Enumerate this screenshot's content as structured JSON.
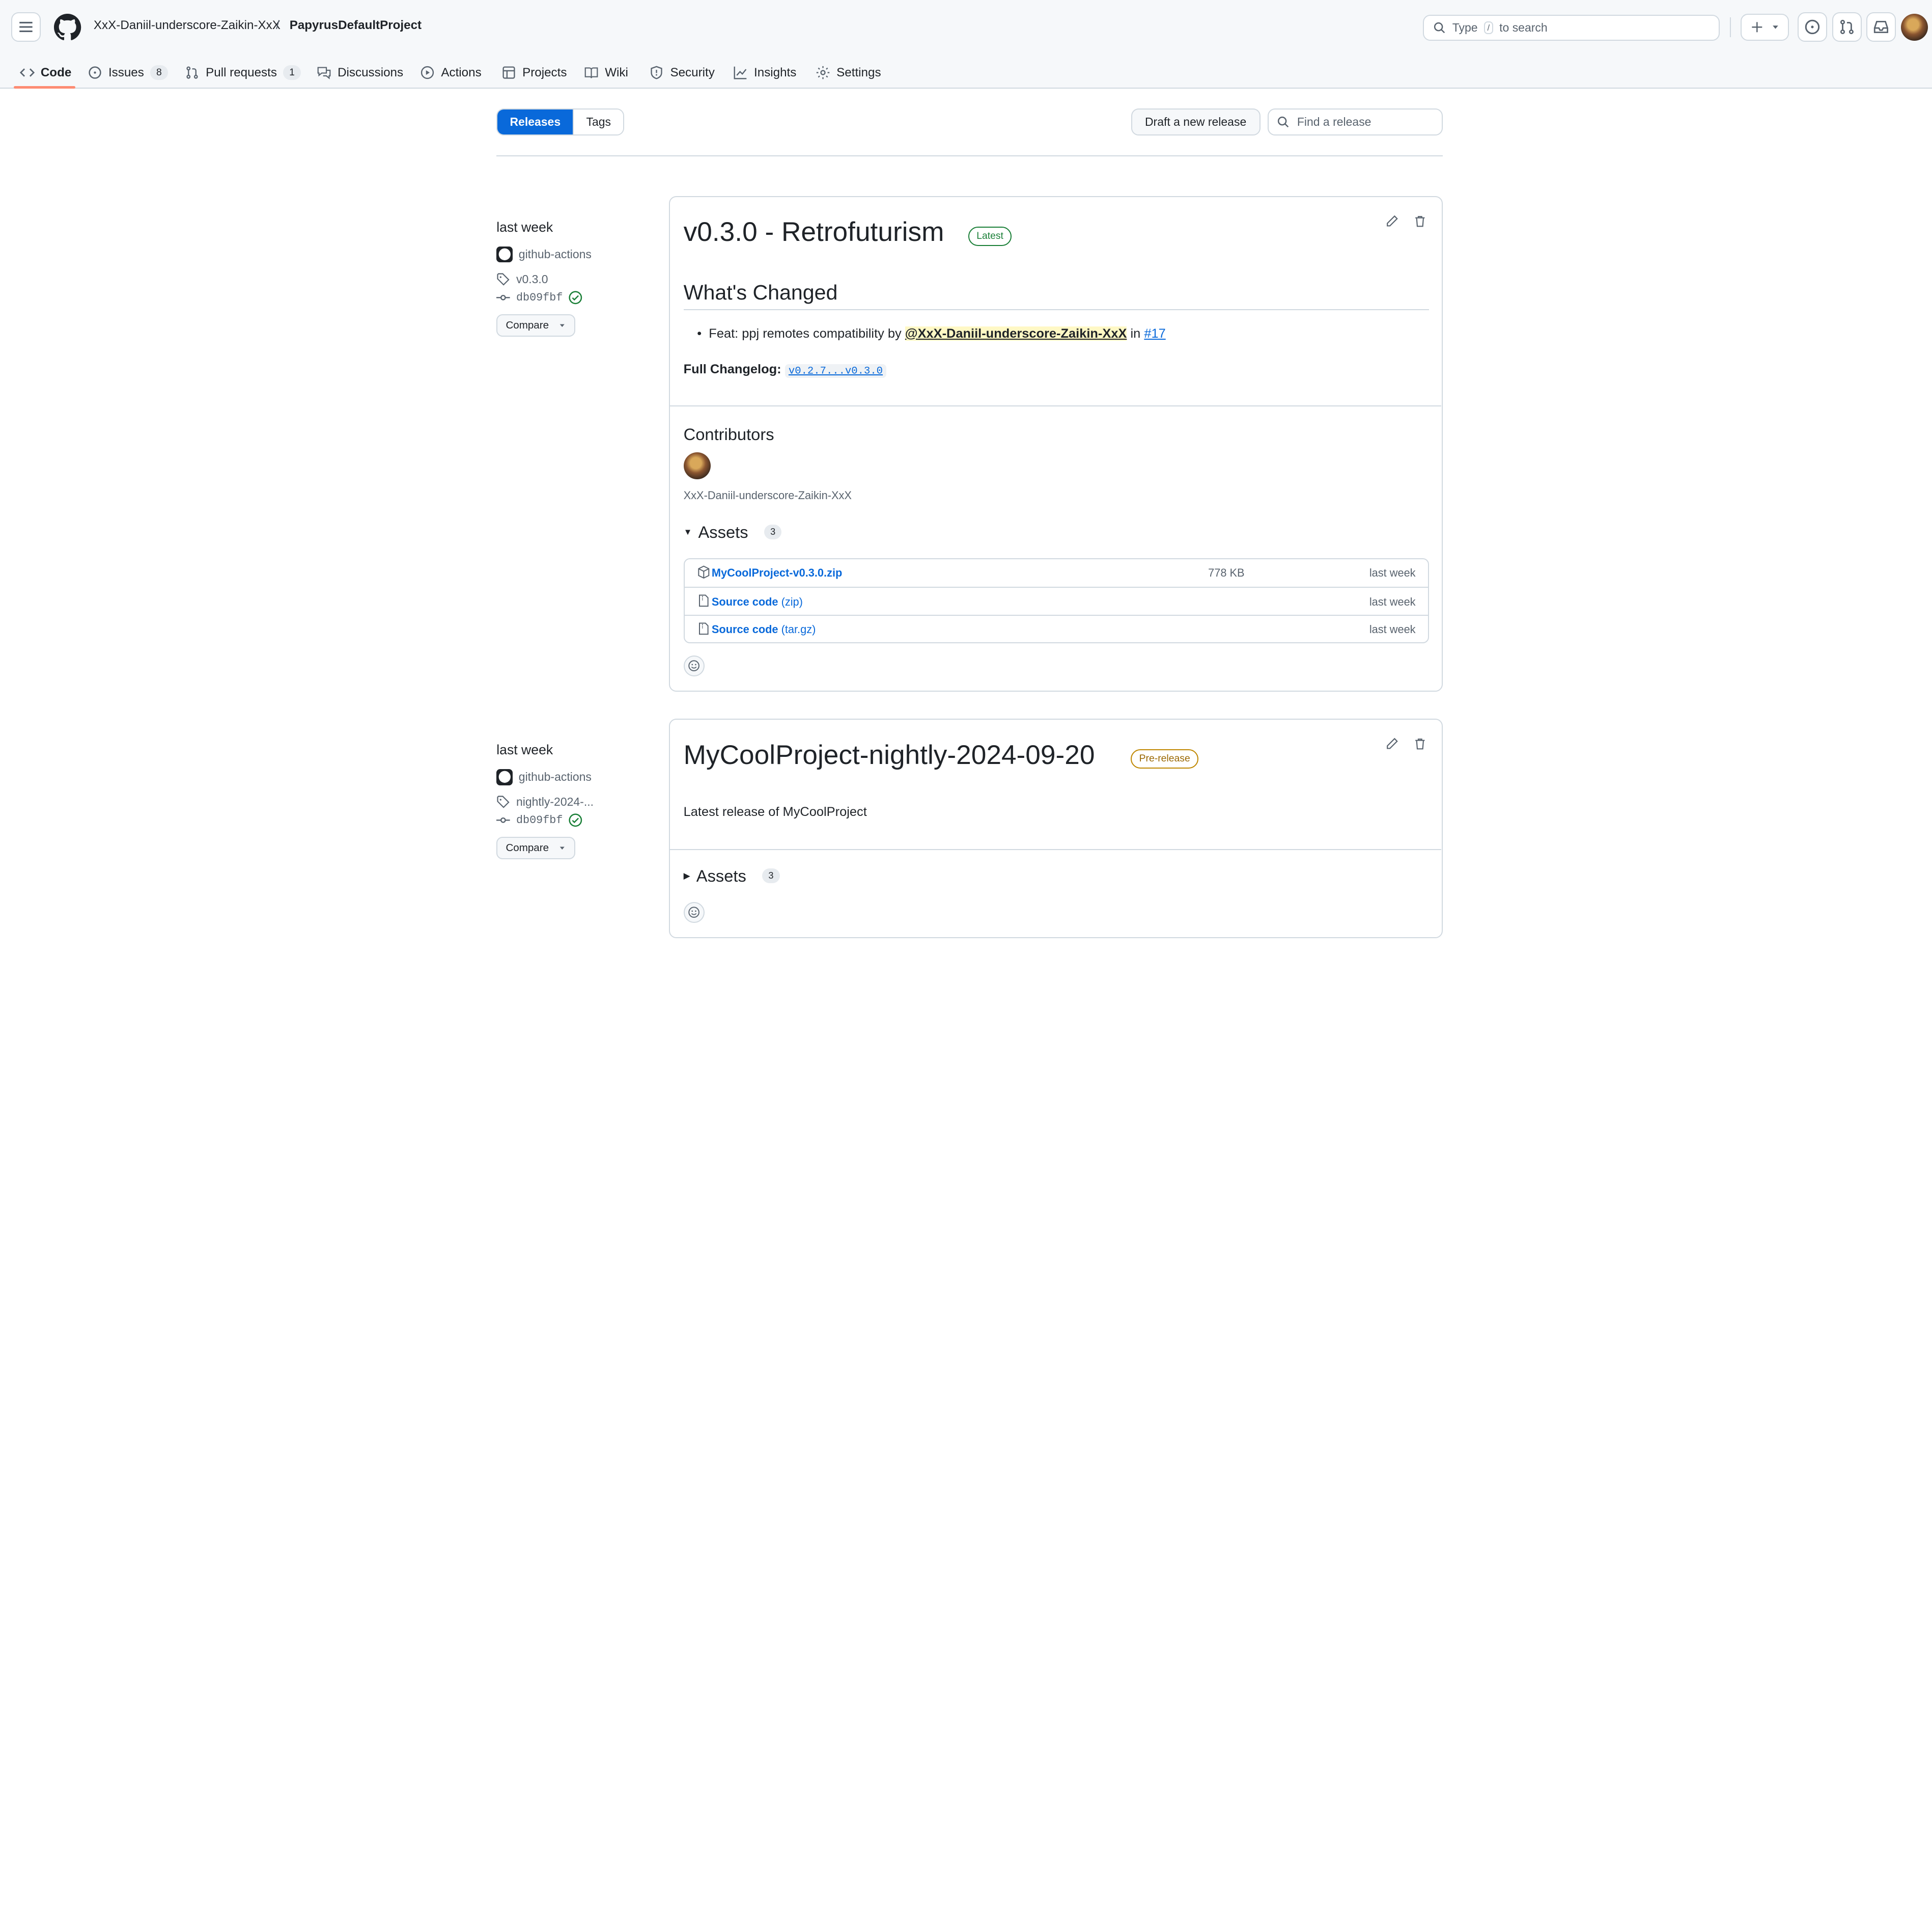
{
  "header": {
    "owner": "XxX-Daniil-underscore-Zaikin-XxX",
    "separator": "/",
    "repo": "PapyrusDefaultProject",
    "search_prefix": "Type",
    "search_key": "/",
    "search_suffix": "to search"
  },
  "tabs": [
    {
      "label": "Code",
      "icon": "code-icon"
    },
    {
      "label": "Issues",
      "count": "8",
      "icon": "issue-icon"
    },
    {
      "label": "Pull requests",
      "count": "1",
      "icon": "pull-request-icon"
    },
    {
      "label": "Discussions",
      "icon": "discussion-icon"
    },
    {
      "label": "Actions",
      "icon": "play-icon"
    },
    {
      "label": "Projects",
      "icon": "table-icon"
    },
    {
      "label": "Wiki",
      "icon": "book-icon"
    },
    {
      "label": "Security",
      "icon": "shield-icon"
    },
    {
      "label": "Insights",
      "icon": "graph-icon"
    },
    {
      "label": "Settings",
      "icon": "gear-icon"
    }
  ],
  "subnav": {
    "releases": "Releases",
    "tags": "Tags",
    "draft_button": "Draft a new release",
    "find_placeholder": "Find a release"
  },
  "releases": [
    {
      "date": "last week",
      "author": "github-actions",
      "tag": "v0.3.0",
      "commit": "db09fbf",
      "compare": "Compare",
      "title": "v0.3.0 - Retrofuturism",
      "label": "Latest",
      "whats_changed": "What's Changed",
      "bullet_prefix": "Feat: ppj remotes compatibility by",
      "bullet_mention": "@XxX-Daniil-underscore-Zaikin-XxX",
      "bullet_in": "in",
      "bullet_pr": "#17",
      "changelog_label": "Full Changelog:",
      "changelog_link": "v0.2.7...v0.3.0",
      "contributors_title": "Contributors",
      "contributor_name": "XxX-Daniil-underscore-Zaikin-XxX",
      "assets_title": "Assets",
      "assets_count": "3",
      "assets": [
        {
          "name": "MyCoolProject-v0.3.0.zip",
          "suffix": "",
          "size": "778 KB",
          "date": "last week"
        },
        {
          "name": "Source code",
          "suffix": "(zip)",
          "size": "",
          "date": "last week"
        },
        {
          "name": "Source code",
          "suffix": "(tar.gz)",
          "size": "",
          "date": "last week"
        }
      ]
    },
    {
      "date": "last week",
      "author": "github-actions",
      "tag": "nightly-2024-...",
      "commit": "db09fbf",
      "compare": "Compare",
      "title": "MyCoolProject-nightly-2024-09-20",
      "label": "Pre-release",
      "description": "Latest release of MyCoolProject",
      "assets_title": "Assets",
      "assets_count": "3"
    }
  ],
  "colors": {
    "accent": "#0969da",
    "latest": "#1a7f37",
    "prerelease": "#9a6700",
    "tab_underline": "#fd8c73"
  }
}
